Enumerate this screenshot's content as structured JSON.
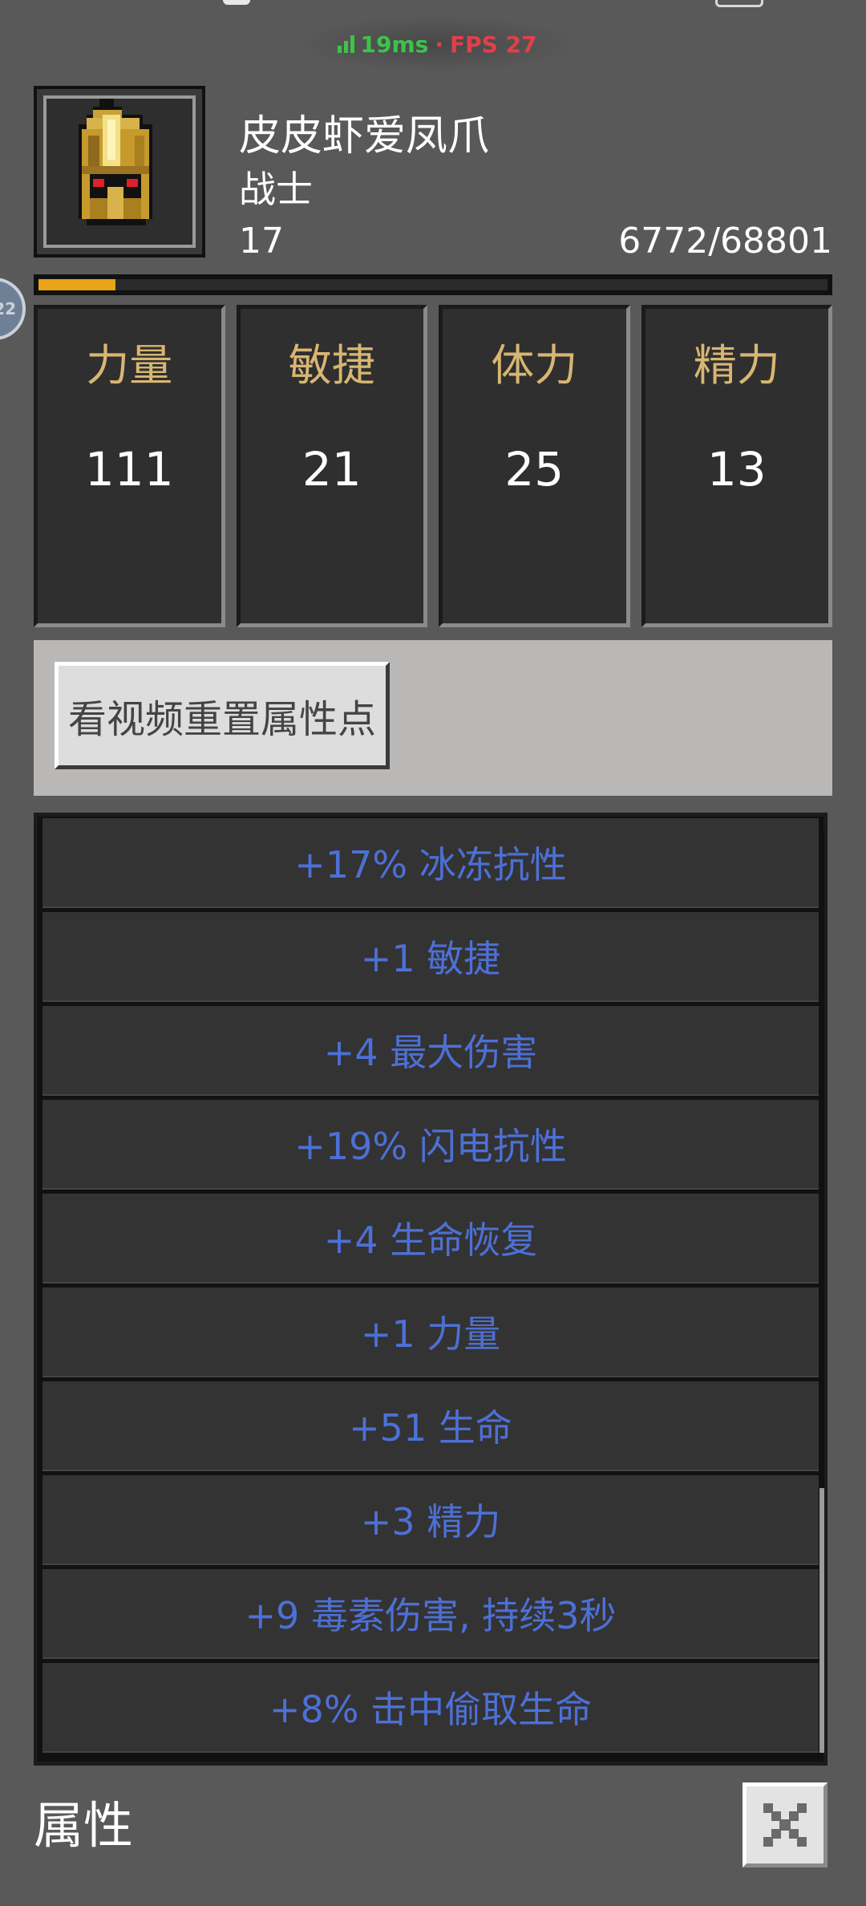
{
  "status": {
    "ping": "19ms",
    "separator": "·",
    "fps": "FPS 27",
    "ping_color": "#3ec24b",
    "fps_color": "#e0404a"
  },
  "side_bubble": {
    "text": "22"
  },
  "character": {
    "name": "皮皮虾爱凤爪",
    "class": "战士",
    "level": "17",
    "exp": "6772/68801",
    "exp_fraction": 0.098,
    "portrait_icon": "golden-helmet-icon"
  },
  "stats": [
    {
      "label": "力量",
      "value": "111"
    },
    {
      "label": "敏捷",
      "value": "21"
    },
    {
      "label": "体力",
      "value": "25"
    },
    {
      "label": "精力",
      "value": "13"
    }
  ],
  "reset_button": {
    "label": "看视频重置属性点"
  },
  "affixes": [
    "+17% 冰冻抗性",
    "+1 敏捷",
    "+4 最大伤害",
    "+19% 闪电抗性",
    "+4 生命恢复",
    "+1 力量",
    "+51 生命",
    "+3 精力",
    "+9 毒素伤害, 持续3秒",
    "+8% 击中偷取生命"
  ],
  "footer": {
    "title": "属性",
    "close_icon": "close-icon"
  },
  "colors": {
    "background": "#595959",
    "stat_label": "#d8b672",
    "affix_text": "#4d70d6",
    "exp_fill": "#e8a416"
  }
}
